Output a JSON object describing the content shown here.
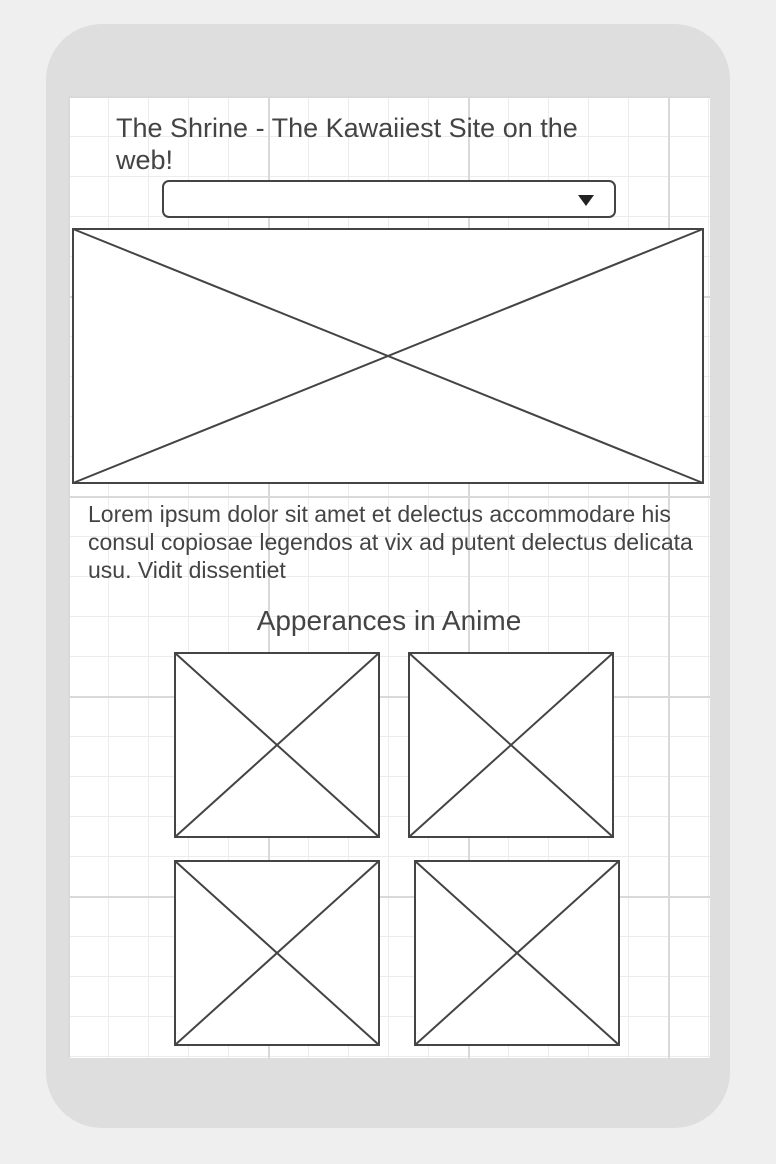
{
  "header": {
    "site_title": "The Shrine - The Kawaiiest Site on the web!"
  },
  "dropdown": {
    "selected_value": ""
  },
  "hero": {
    "image_icon": "image-placeholder-icon"
  },
  "content": {
    "paragraph": "Lorem ipsum dolor sit amet et delectus accommodare his consul copiosae legendos at vix ad putent delectus delicata usu. Vidit dissentiet"
  },
  "appearances": {
    "title": "Apperances in Anime",
    "thumb_icon": "image-placeholder-icon"
  },
  "colors": {
    "stroke": "#444444",
    "device": "#dedede",
    "background": "#efefef",
    "grid": "#d9d9d9"
  }
}
